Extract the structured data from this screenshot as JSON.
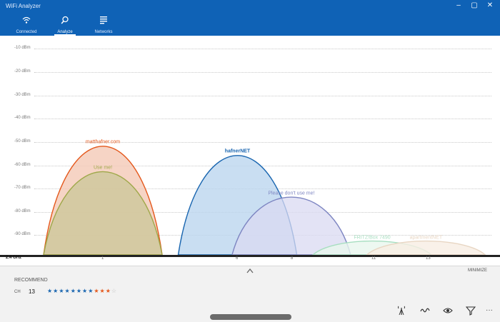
{
  "app": {
    "title": "WiFi Analyzer"
  },
  "window_controls": [
    "–",
    "▢",
    "✕"
  ],
  "tabs": [
    {
      "label": "Connected",
      "icon": "wifi-icon",
      "active": false
    },
    {
      "label": "Analyze",
      "icon": "search-icon",
      "active": true
    },
    {
      "label": "Networks",
      "icon": "list-icon",
      "active": false
    }
  ],
  "chart_data": {
    "type": "area",
    "y_axis_labels": [
      "-10 dBm",
      "-20 dBm",
      "-30 dBm",
      "-40 dBm",
      "-50 dBm",
      "-60 dBm",
      "-70 dBm",
      "-80 dBm",
      "-90 dBm"
    ],
    "ylim": [
      -100,
      -10
    ],
    "x_band_label": "2.4 GHz",
    "x_ticks": [
      "1",
      "6",
      "8",
      "11",
      "13"
    ],
    "networks": [
      {
        "name": "matthafner.com",
        "channel": 1,
        "signal_dbm": -53,
        "color": "#e4581c",
        "fill": "#f4c9b6"
      },
      {
        "name": "Use me!",
        "channel": 1,
        "signal_dbm": -64,
        "color": "#9fa84a",
        "fill": "#cdc79a"
      },
      {
        "name": "hafnerNET",
        "channel": 6,
        "signal_dbm": -57,
        "color": "#1a66b0",
        "fill": "#bcd6ef"
      },
      {
        "name": "Please don't use me!",
        "channel": 8,
        "signal_dbm": -75,
        "color": "#7e86c2",
        "fill": "#dad9f1"
      },
      {
        "name": "FRITZ!Box 7490",
        "channel": 11,
        "signal_dbm": -94,
        "color": "#a7dec0",
        "fill": "#e8f6ee"
      },
      {
        "name": "apartmentNET",
        "channel": 13,
        "signal_dbm": -94,
        "color": "#e8d6c3",
        "fill": "#f7eee4"
      }
    ],
    "grid": true
  },
  "bottom": {
    "collapse_icon": "chevron-up-icon",
    "minimize_label": "MINIMIZE",
    "recommend_label": "RECOMMEND",
    "channel_label": "CH",
    "channel_value": "13",
    "rating_stars": {
      "blue": 8,
      "orange": 3,
      "empty": 1
    }
  },
  "cmdbar": {
    "icons": [
      "signal-tower-icon",
      "pulse-icon",
      "eye-icon",
      "filter-icon",
      "more-icon"
    ],
    "more_label": "···"
  }
}
